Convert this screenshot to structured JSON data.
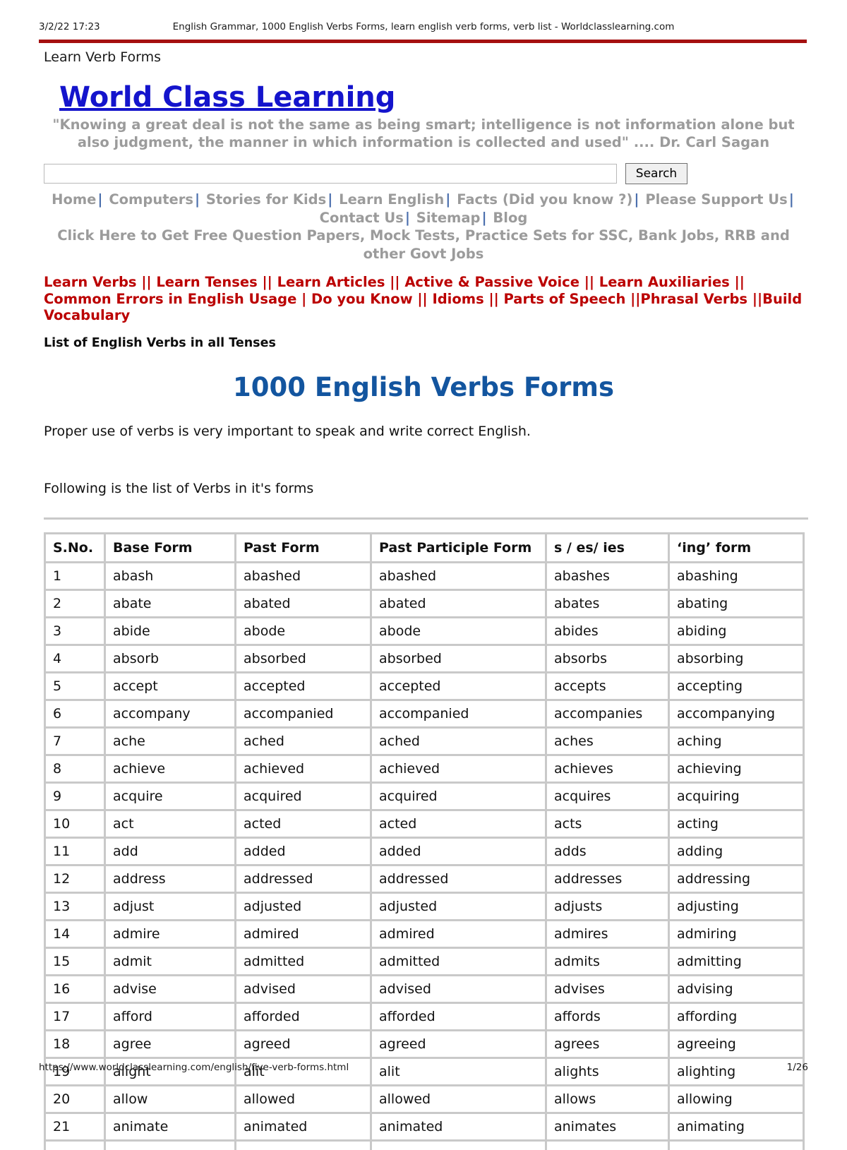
{
  "print_header": {
    "date": "3/2/22 17:23",
    "title": "English Grammar, 1000 English Verbs Forms, learn english verb forms, verb list - Worldclasslearning.com",
    "rule_color": "#a51010"
  },
  "breadcrumb": "Learn Verb Forms",
  "site": {
    "title": "World Class Learning",
    "title_color": "#1414cc",
    "tagline": "\"Knowing a great deal is not the same as being smart; intelligence is not information alone but also judgment, the manner in which information is collected and used\" .... Dr. Carl Sagan"
  },
  "search": {
    "value": "",
    "placeholder": "",
    "button_label": "Search"
  },
  "gray_nav": {
    "color": "#9b9b9b",
    "separator": "|",
    "items": [
      "Home",
      "Computers",
      "Stories for Kids",
      "Learn English",
      "Facts (Did you know ?)",
      "Please Support Us",
      "Contact Us",
      "Sitemap",
      "Blog"
    ],
    "promo": "Click Here to Get Free Question Papers, Mock Tests, Practice Sets for SSC, Bank Jobs, RRB and other Govt Jobs"
  },
  "red_nav": {
    "color": "#bb0000",
    "items": [
      {
        "label": "Learn Verbs",
        "sep": "||"
      },
      {
        "label": "Learn Tenses",
        "sep": "||"
      },
      {
        "label": "Learn Articles",
        "sep": "||"
      },
      {
        "label": "Active & Passive Voice",
        "sep": "||"
      },
      {
        "label": "Learn Auxiliaries",
        "sep": "||"
      },
      {
        "label": "Common Errors in English Usage",
        "sep": "|"
      },
      {
        "label": "Do you Know",
        "sep": "||"
      },
      {
        "label": "Idioms",
        "sep": "||"
      },
      {
        "label": "Parts of Speech",
        "sep": "||"
      },
      {
        "label": "Phrasal Verbs",
        "sep": "||"
      },
      {
        "label": "Build Vocabulary",
        "sep": ""
      }
    ]
  },
  "subhead": "List of English Verbs in all Tenses",
  "main_title": "1000 English Verbs Forms",
  "main_title_color": "#13559f",
  "paragraphs": {
    "intro": "Proper use of verbs is very important to speak and write correct English.",
    "following": "Following is the list of Verbs in it's forms"
  },
  "table": {
    "headers": [
      "S.No.",
      "Base Form",
      "Past Form",
      "Past Participle Form",
      "s / es/ ies",
      "‘ing’ form"
    ],
    "rows": [
      [
        "1",
        "abash",
        "abashed",
        "abashed",
        "abashes",
        "abashing"
      ],
      [
        "2",
        "abate",
        "abated",
        "abated",
        "abates",
        "abating"
      ],
      [
        "3",
        "abide",
        "abode",
        "abode",
        "abides",
        "abiding"
      ],
      [
        "4",
        "absorb",
        "absorbed",
        "absorbed",
        "absorbs",
        "absorbing"
      ],
      [
        "5",
        "accept",
        "accepted",
        "accepted",
        "accepts",
        "accepting"
      ],
      [
        "6",
        "accompany",
        "accompanied",
        "accompanied",
        "accompanies",
        "accompanying"
      ],
      [
        "7",
        "ache",
        "ached",
        "ached",
        "aches",
        "aching"
      ],
      [
        "8",
        "achieve",
        "achieved",
        "achieved",
        "achieves",
        "achieving"
      ],
      [
        "9",
        "acquire",
        "acquired",
        "acquired",
        "acquires",
        "acquiring"
      ],
      [
        "10",
        "act",
        "acted",
        "acted",
        "acts",
        "acting"
      ],
      [
        "11",
        "add",
        "added",
        "added",
        "adds",
        "adding"
      ],
      [
        "12",
        "address",
        "addressed",
        "addressed",
        "addresses",
        "addressing"
      ],
      [
        "13",
        "adjust",
        "adjusted",
        "adjusted",
        "adjusts",
        "adjusting"
      ],
      [
        "14",
        "admire",
        "admired",
        "admired",
        "admires",
        "admiring"
      ],
      [
        "15",
        "admit",
        "admitted",
        "admitted",
        "admits",
        "admitting"
      ],
      [
        "16",
        "advise",
        "advised",
        "advised",
        "advises",
        "advising"
      ],
      [
        "17",
        "afford",
        "afforded",
        "afforded",
        "affords",
        "affording"
      ],
      [
        "18",
        "agree",
        "agreed",
        "agreed",
        "agrees",
        "agreeing"
      ],
      [
        "19",
        "alight",
        "alit",
        "alit",
        "alights",
        "alighting"
      ],
      [
        "20",
        "allow",
        "allowed",
        "allowed",
        "allows",
        "allowing"
      ],
      [
        "21",
        "animate",
        "animated",
        "animated",
        "animates",
        "animating"
      ]
    ]
  },
  "print_footer": {
    "url": "https://www.worldclasslearning.com/english/five-verb-forms.html",
    "page": "1/26"
  }
}
